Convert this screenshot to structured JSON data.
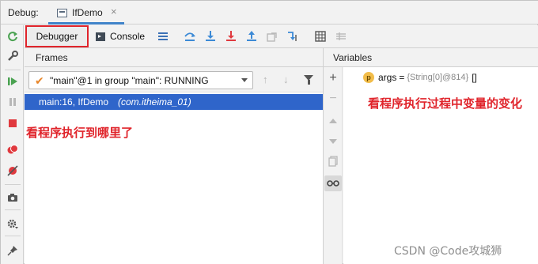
{
  "window": {
    "title_label": "Debug:",
    "tab_title": "IfDemo",
    "tab_close": "×"
  },
  "toolbar": {
    "debugger_label": "Debugger",
    "console_label": "Console"
  },
  "frames": {
    "title": "Frames",
    "thread_selected": "\"main\"@1 in group \"main\": RUNNING",
    "rows": [
      {
        "method": "main:16, IfDemo",
        "package": "(com.itheima_01)"
      }
    ]
  },
  "variables": {
    "title": "Variables",
    "items": [
      {
        "badge": "p",
        "name": "args",
        "eq": "=",
        "type": "{String[0]@814}",
        "value": "[]"
      }
    ]
  },
  "annotations": {
    "left": "看程序执行到哪里了",
    "right": "看程序执行过程中变量的变化"
  },
  "watermark": "CSDN @Code攻城狮",
  "colors": {
    "accent_blue": "#2f65ca",
    "highlight_red": "#e0242b",
    "tab_underline": "#4083c9"
  },
  "icons": {
    "left_toolbar": [
      "rerun-icon",
      "settings-wrench-icon",
      "resume-icon",
      "pause-icon",
      "stop-icon",
      "view-breakpoints-icon",
      "mute-breakpoints-icon",
      "camera-icon",
      "gear-icon",
      "pin-icon"
    ],
    "top_toolbar": [
      "layout-icon",
      "step-over-icon",
      "step-into-icon",
      "force-step-into-icon",
      "step-out-icon",
      "drop-frame-icon",
      "run-to-cursor-icon",
      "evaluate-expression-icon",
      "trace-icon"
    ],
    "variables_toolbar": [
      "add-icon",
      "remove-icon",
      "up-icon",
      "down-icon",
      "copy-icon",
      "glasses-icon"
    ]
  }
}
